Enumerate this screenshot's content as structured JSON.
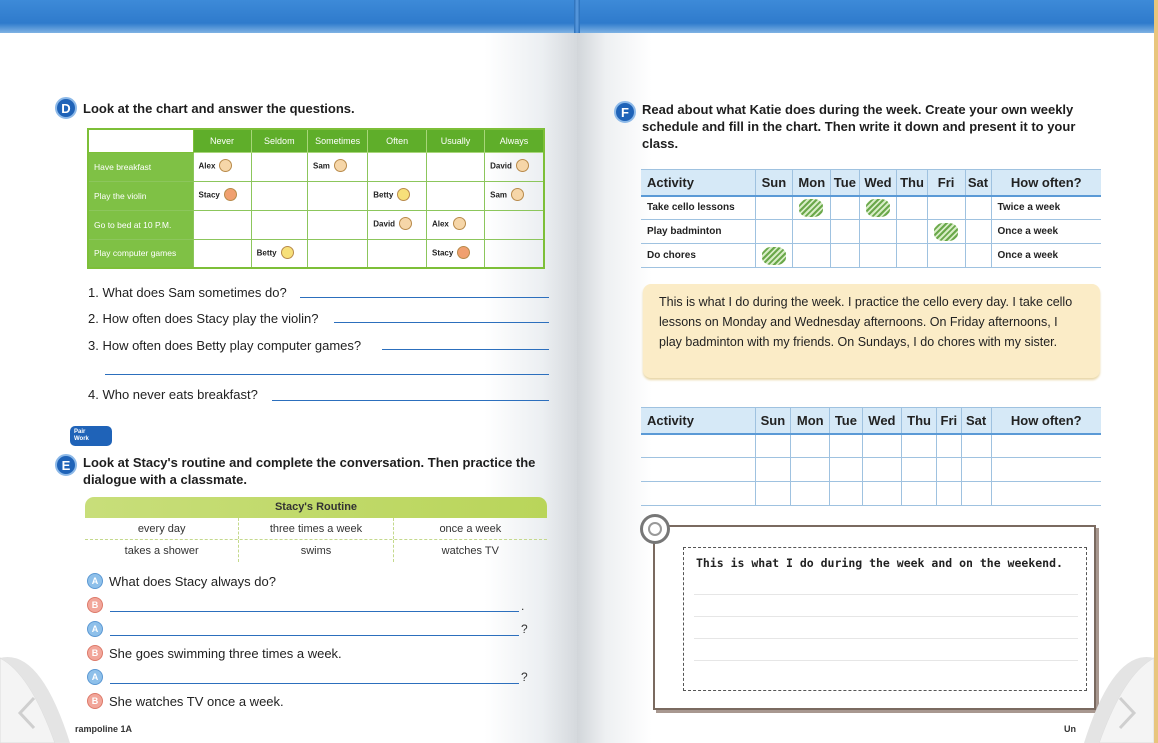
{
  "sectionD": {
    "badge": "D",
    "title": "Look at the chart and answer the questions.",
    "columns": [
      "Never",
      "Seldom",
      "Sometimes",
      "Often",
      "Usually",
      "Always"
    ],
    "rows": [
      {
        "label": "Have breakfast",
        "cells": [
          "Alex",
          "",
          "Sam",
          "",
          "",
          "David"
        ]
      },
      {
        "label": "Play the violin",
        "cells": [
          "Stacy",
          "",
          "",
          "Betty",
          "",
          "Sam"
        ]
      },
      {
        "label": "Go to bed at 10 P.M.",
        "cells": [
          "",
          "",
          "",
          "David",
          "Alex",
          ""
        ]
      },
      {
        "label": "Play computer games",
        "cells": [
          "",
          "Betty",
          "",
          "",
          "Stacy",
          ""
        ]
      }
    ],
    "questions": [
      "1. What does Sam sometimes do?",
      "2. How often does Stacy play the violin?",
      "3. How often does Betty play computer games?",
      "4. Who never eats breakfast?"
    ]
  },
  "pairwork": {
    "line1": "Pair",
    "line2": "Work"
  },
  "sectionE": {
    "badge": "E",
    "title_line1": "Look at Stacy's routine and complete the conversation. Then practice the",
    "title_line2": "dialogue with a classmate.",
    "routine_title": "Stacy's Routine",
    "frequencies": [
      "every day",
      "three times a week",
      "once a week"
    ],
    "activities": [
      "takes a shower",
      "swims",
      "watches TV"
    ],
    "conversation": [
      {
        "speaker": "A",
        "text": "What does Stacy always do?",
        "end": ""
      },
      {
        "speaker": "B",
        "text": "",
        "end": "."
      },
      {
        "speaker": "A",
        "text": "",
        "end": "?"
      },
      {
        "speaker": "B",
        "text": "She goes swimming three times a week.",
        "end": ""
      },
      {
        "speaker": "A",
        "text": "",
        "end": "?"
      },
      {
        "speaker": "B",
        "text": "She watches TV once a week.",
        "end": ""
      }
    ]
  },
  "footer_left": "rampoline 1A",
  "footer_right": "Un",
  "sectionF": {
    "badge": "F",
    "title_line1": "Read about what Katie does during the week. Create your own weekly",
    "title_line2": "schedule and fill in the chart. Then write it down and present it to your",
    "title_line3": "class.",
    "headers": [
      "Activity",
      "Sun",
      "Mon",
      "Tue",
      "Wed",
      "Thu",
      "Fri",
      "Sat",
      "How often?"
    ],
    "rows": [
      {
        "activity": "Take cello lessons",
        "how_often": "Twice a week"
      },
      {
        "activity": "Play badminton",
        "how_often": "Once a week"
      },
      {
        "activity": "Do chores",
        "how_often": "Once a week"
      }
    ],
    "story": "This is what I do during the week. I practice the cello every day. I take cello lessons on Monday and Wednesday afternoons. On Friday afternoons, I play badminton with my friends. On Sundays, I do chores with my sister.",
    "note_prompt": "This is what I do during the week and on the weekend."
  }
}
